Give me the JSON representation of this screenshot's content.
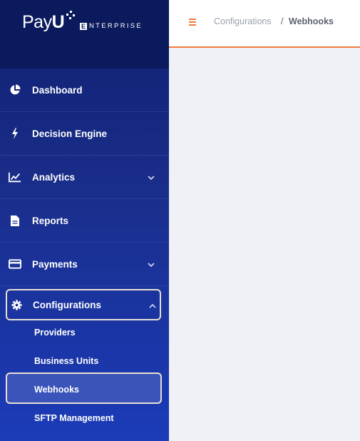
{
  "brand": {
    "name_left": "Pay",
    "name_u": "U",
    "badge_letter": "E",
    "sub": "NTERPRISE"
  },
  "nav": {
    "dashboard": "Dashboard",
    "decision_engine": "Decision Engine",
    "analytics": "Analytics",
    "reports": "Reports",
    "payments": "Payments",
    "configurations": "Configurations"
  },
  "submenu": {
    "providers": "Providers",
    "business_units": "Business Units",
    "webhooks": "Webhooks",
    "sftp": "SFTP Management"
  },
  "breadcrumb": {
    "parent": "Configurations",
    "separator": "/",
    "current": "Webhooks"
  },
  "colors": {
    "accent": "#f07c3a",
    "sidebar": "#1a2e8c",
    "crumb_parent": "#9aa0ac",
    "crumb_current": "#5c6270"
  },
  "icons": [
    "pie-chart-icon",
    "lightning-icon",
    "trend-line-icon",
    "document-icon",
    "credit-card-icon",
    "gear-icon",
    "chevron-down-icon",
    "chevron-up-icon",
    "hamburger-icon"
  ]
}
